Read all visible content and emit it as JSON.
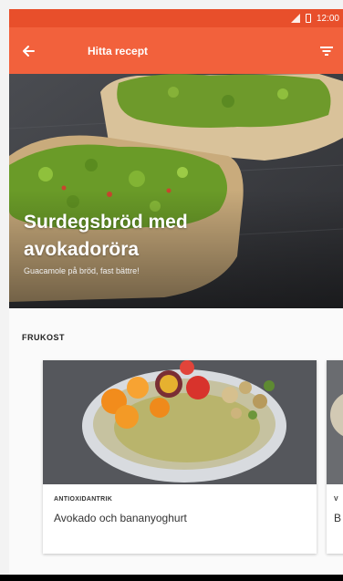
{
  "status_bar": {
    "time": "12:00"
  },
  "app_bar": {
    "title": "Hitta recept"
  },
  "hero": {
    "title": "Surdegsbröd med avokadoröra",
    "subtitle": "Guacamole på bröd, fast bättre!"
  },
  "section": {
    "title": "FRUKOST"
  },
  "cards": [
    {
      "category": "ANTIOXIDANTRIK",
      "name": "Avokado och bananyoghurt"
    },
    {
      "category": "V",
      "name": "B"
    }
  ],
  "colors": {
    "primary": "#f2613c",
    "status_bar": "#e84f2b"
  },
  "icons": [
    "back-arrow-icon",
    "filter-icon",
    "signal-icon",
    "battery-icon"
  ]
}
